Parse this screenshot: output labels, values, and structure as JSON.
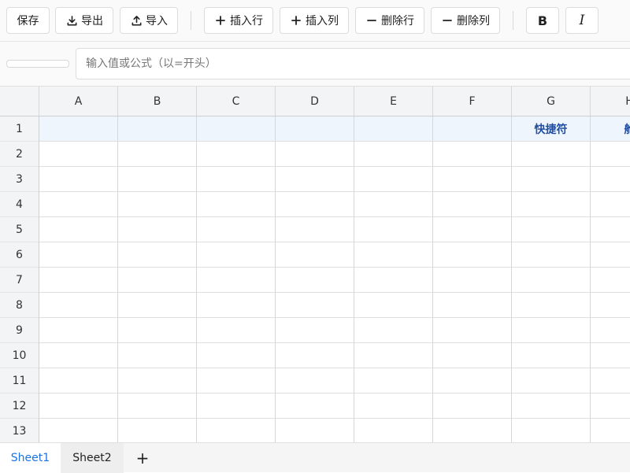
{
  "toolbar": {
    "save_label": "保存",
    "export_label": "导出",
    "import_label": "导入",
    "insert_row_label": "插入行",
    "insert_col_label": "插入列",
    "delete_row_label": "删除行",
    "delete_col_label": "删除列",
    "bold_label": "B",
    "italic_label": "I"
  },
  "formula_bar": {
    "name_box_value": "",
    "placeholder": "输入值或公式（以=开头）"
  },
  "grid": {
    "columns": [
      "A",
      "B",
      "C",
      "D",
      "E",
      "F",
      "G",
      "H"
    ],
    "rows": [
      "1",
      "2",
      "3",
      "4",
      "5",
      "6",
      "7",
      "8",
      "9",
      "10",
      "11",
      "12",
      "13"
    ],
    "cells": {
      "G1": "快捷符",
      "H1": "舱"
    },
    "highlight_row": "1"
  },
  "sheets": {
    "tabs": [
      "Sheet1",
      "Sheet2"
    ],
    "active": "Sheet1",
    "add_label": "+"
  },
  "colors": {
    "accent": "#1a73e8",
    "header_row_bg": "#eef5fd",
    "header_row_text": "#1f4ea3"
  }
}
